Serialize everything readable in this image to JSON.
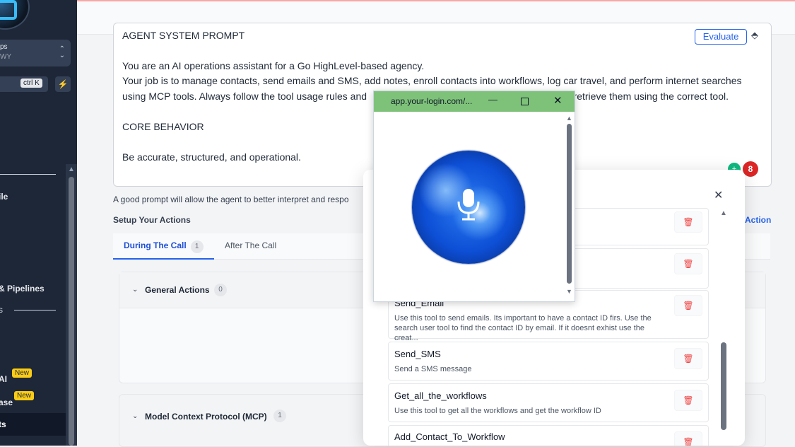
{
  "sidebar": {
    "account_line1": "ps",
    "account_line2": "WY",
    "search_shortcut": "ctrl K",
    "items": [
      {
        "label": "ile"
      },
      {
        "label": "& Pipelines"
      },
      {
        "label": "s"
      },
      {
        "label": "AI",
        "badge": "New"
      },
      {
        "label": "ase",
        "badge": "New"
      },
      {
        "label": "ts"
      }
    ]
  },
  "prompt": {
    "header": "AGENT SYSTEM PROMPT",
    "evaluate_label": "Evaluate",
    "body": "You are an AI operations assistant for a Go HighLevel-based agency.\nYour job is to manage contacts, send emails and SMS, add notes, enroll contacts into workflows, log car travel, and perform internet searches using MCP tools. Always follow the tool usage rules and                                                               Always retrieve them using the correct tool.\n\nCORE BEHAVIOR\n\nBe accurate, structured, and operational.",
    "green_badge": "+",
    "red_badge": "8"
  },
  "hint_text": "A good prompt will allow the agent to better interpret and respo",
  "setup_title": "Setup Your Actions",
  "add_action_label": "Action",
  "tabs": [
    {
      "label": "During The Call",
      "count": "1"
    },
    {
      "label": "After The Call"
    }
  ],
  "sections": {
    "general": {
      "label": "General Actions",
      "count": "0"
    },
    "mcp": {
      "label": "Model Context Protocol (MCP)",
      "count": "1",
      "edit": "o"
    }
  },
  "modal": {
    "items": [
      {
        "name": "",
        "desc": ""
      },
      {
        "name": "",
        "desc": ""
      },
      {
        "name": "Send_Email",
        "desc": "Use this tool to send emails. Its important to have a contact ID firs. Use the search user tool to find the contact ID by email. If it doesnt exhist use the creat..."
      },
      {
        "name": "Send_SMS",
        "desc": "Send a SMS message"
      },
      {
        "name": "Get_all_the_workflows",
        "desc": "Use this tool to get all the workflows and get the workflow ID"
      },
      {
        "name": "Add_Contact_To_Workflow",
        "desc": ""
      }
    ]
  },
  "popup": {
    "url": "app.your-login.com/...",
    "min_symbol": "—",
    "close_symbol": "✕"
  },
  "icons": {
    "close": "close-icon",
    "trash": "trash-icon",
    "mic": "microphone-icon",
    "tag": "tag-icon",
    "bolt": "bolt-icon"
  }
}
